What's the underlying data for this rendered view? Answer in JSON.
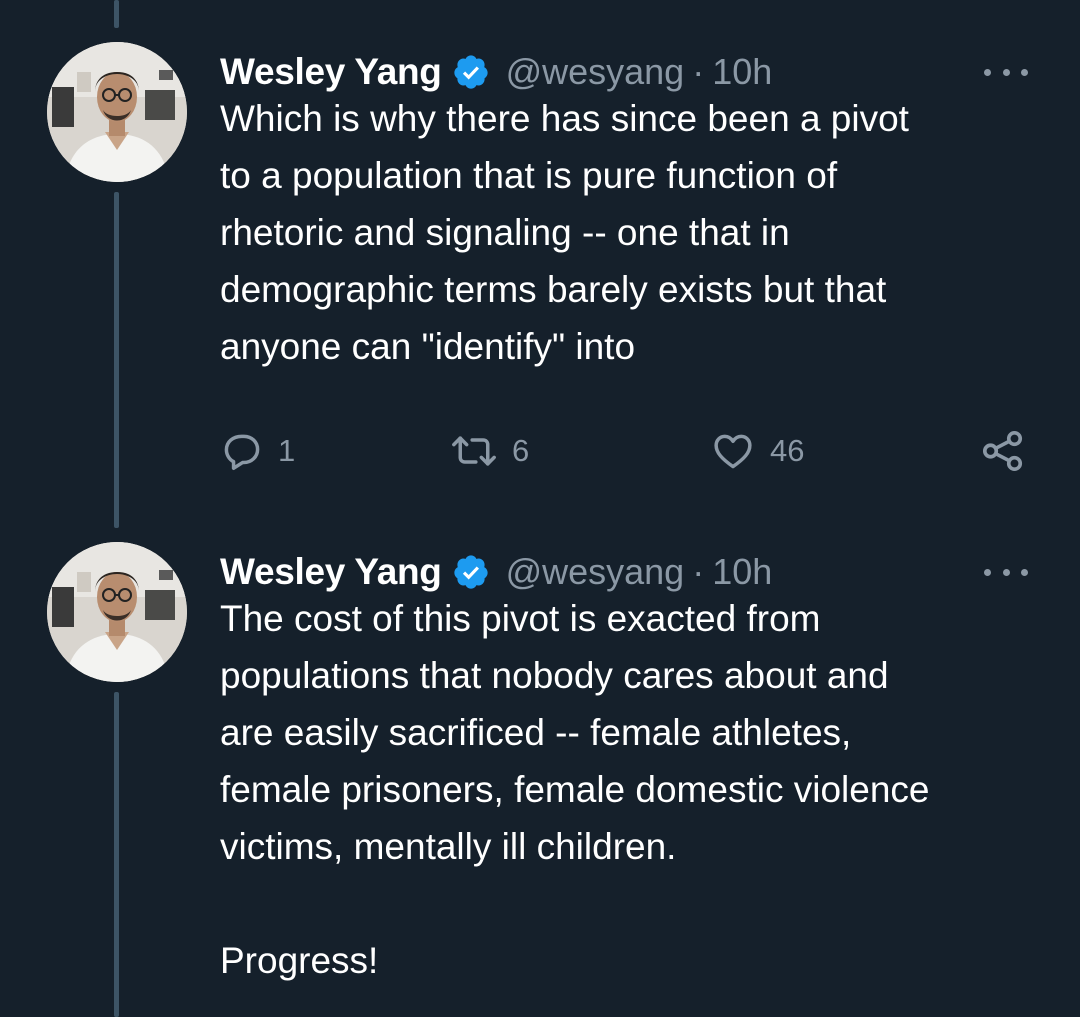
{
  "tweets": [
    {
      "author": {
        "name": "Wesley Yang",
        "handle": "@wesyang",
        "verified": true,
        "avatar": "avatar-man-glasses-white-shirt"
      },
      "separator": "·",
      "time": "10h",
      "text": "Which is why there has since been a pivot\nto a population that is pure function of\nrhetoric and signaling -- one that in\ndemographic terms barely exists but that\nanyone can \"identify\" into",
      "stats": {
        "replies": "1",
        "retweets": "6",
        "likes": "46"
      }
    },
    {
      "author": {
        "name": "Wesley Yang",
        "handle": "@wesyang",
        "verified": true,
        "avatar": "avatar-man-glasses-white-shirt"
      },
      "separator": "·",
      "time": "10h",
      "text": "The cost of this pivot is exacted from\npopulations that nobody cares about and\nare easily sacrificed -- female athletes,\nfemale prisoners, female domestic violence\nvictims, mentally ill children.\n\nProgress!"
    }
  ],
  "icons": {
    "verified": "verified-badge-icon",
    "more": "more-options-icon",
    "reply": "reply-icon",
    "retweet": "retweet-icon",
    "like": "heart-icon",
    "share": "share-icon"
  },
  "colors": {
    "background": "#15202b",
    "text_primary": "#ffffff",
    "text_secondary": "#8b98a5",
    "verified_blue": "#1d9bf0",
    "thread_line": "#3d5466"
  }
}
